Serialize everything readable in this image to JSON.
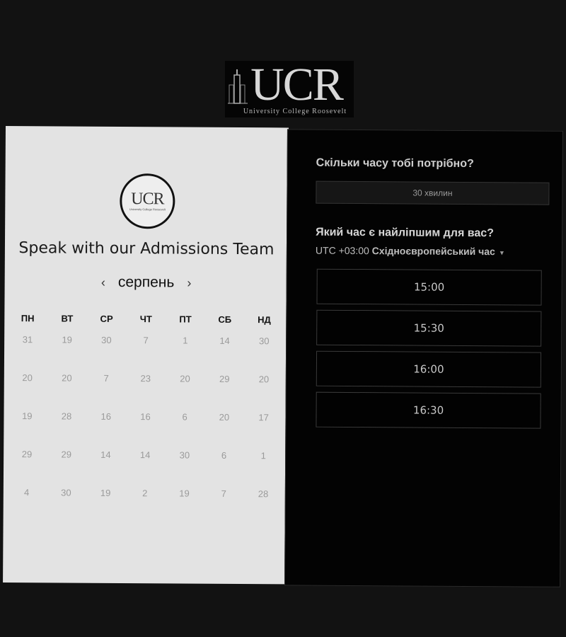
{
  "header": {
    "logo_text": "UCR",
    "logo_subtitle": "University College Roosevelt"
  },
  "calendar_panel": {
    "logo_text": "UCR",
    "title": "Speak with our Admissions Team",
    "month": "серпень",
    "prev_arrow": "‹",
    "next_arrow": "›",
    "weekdays": [
      "ПН",
      "ВТ",
      "СР",
      "ЧТ",
      "ПТ",
      "СБ",
      "НД"
    ],
    "weeks": [
      [
        "31",
        "19",
        "30",
        "7",
        "1",
        "14",
        "30"
      ],
      [
        "20",
        "20",
        "7",
        "23",
        "20",
        "29",
        "20"
      ],
      [
        "19",
        "28",
        "16",
        "16",
        "6",
        "20",
        "17"
      ],
      [
        "29",
        "29",
        "14",
        "14",
        "30",
        "6",
        "1"
      ],
      [
        "4",
        "30",
        "19",
        "2",
        "19",
        "7",
        "28"
      ]
    ]
  },
  "booking_panel": {
    "duration_question": "Скільки часу тобі потрібно?",
    "duration_value": "30 хвилин",
    "time_question": "Який час є найліпшим для вас?",
    "timezone_offset": "UTC +03:00",
    "timezone_name": "Східноєвропейський час",
    "slots": [
      "15:00",
      "15:30",
      "16:00",
      "16:30"
    ]
  },
  "colors": {
    "page_background": "#121212",
    "calendar_background": "#e3e3e3",
    "booking_background": "#030303"
  }
}
